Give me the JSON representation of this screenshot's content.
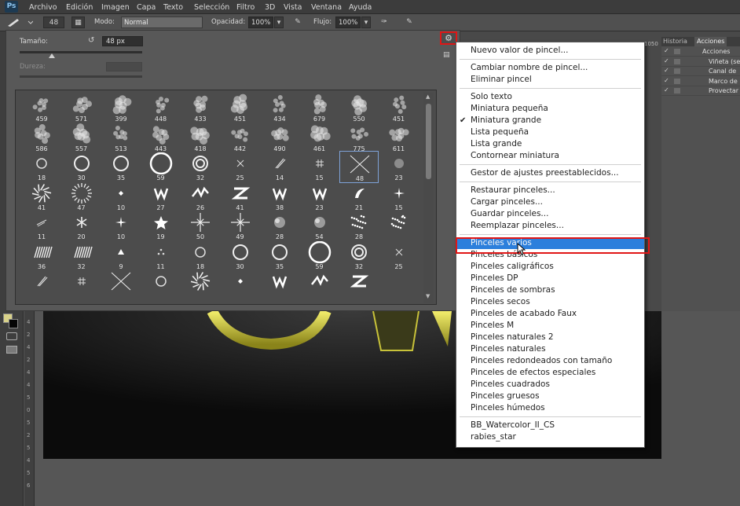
{
  "menubar": {
    "logo": "Ps",
    "items": [
      "Archivo",
      "Edición",
      "Imagen",
      "Capa",
      "Texto",
      "Selección",
      "Filtro",
      "3D",
      "Vista",
      "Ventana",
      "Ayuda"
    ]
  },
  "options": {
    "brush_size": "48",
    "mode_label": "Modo:",
    "mode_value": "Normal",
    "opacity_label": "Opacidad:",
    "opacity_value": "100%",
    "flow_label": "Flujo:",
    "flow_value": "100%"
  },
  "picker": {
    "size_label": "Tamaño:",
    "size_value": "48 px",
    "hardness_label": "Dureza:",
    "brush_numbers": [
      [
        "459",
        "571",
        "399",
        "448",
        "433",
        "451",
        "434",
        "679",
        "550",
        "451"
      ],
      [
        "586",
        "557",
        "513",
        "443",
        "418",
        "442",
        "490",
        "461",
        "775",
        "611"
      ],
      [
        "18",
        "30",
        "35",
        "59",
        "32",
        "25",
        "14",
        "15",
        "48",
        "23"
      ],
      [
        "41",
        "47",
        "10",
        "27",
        "26",
        "41",
        "38",
        "23",
        "21",
        "15"
      ],
      [
        "11",
        "20",
        "10",
        "19",
        "50",
        "49",
        "28",
        "54",
        "28",
        ""
      ],
      [
        "36",
        "32",
        "9",
        "11",
        "18",
        "30",
        "35",
        "59",
        "32",
        "25"
      ]
    ],
    "selected_brush": "48"
  },
  "side_panel": {
    "tabs": [
      "Historia",
      "Acciones"
    ],
    "items": [
      "Acciones",
      "Viñeta (se",
      "Canal de",
      "Marco de",
      "Provectar"
    ],
    "ruler_fragment": "1050"
  },
  "ruler_vertical": [
    "4",
    "2",
    "4",
    "2",
    "4",
    "4",
    "5",
    "0",
    "5",
    "2",
    "5",
    "4",
    "5",
    "6"
  ],
  "context_menu": {
    "groups": [
      [
        {
          "label": "Nuevo valor de pincel..."
        }
      ],
      [
        {
          "label": "Cambiar nombre de pincel..."
        },
        {
          "label": "Eliminar pincel"
        }
      ],
      [
        {
          "label": "Solo texto"
        },
        {
          "label": "Miniatura pequeña"
        },
        {
          "label": "Miniatura grande",
          "checked": true
        },
        {
          "label": "Lista pequeña"
        },
        {
          "label": "Lista grande"
        },
        {
          "label": "Contornear miniatura"
        }
      ],
      [
        {
          "label": "Gestor de ajustes preestablecidos..."
        }
      ],
      [
        {
          "label": "Restaurar pinceles..."
        },
        {
          "label": "Cargar pinceles..."
        },
        {
          "label": "Guardar pinceles..."
        },
        {
          "label": "Reemplazar pinceles..."
        }
      ],
      [
        {
          "label": "Pinceles varios",
          "highlighted": true
        },
        {
          "label": "Pinceles básicos"
        },
        {
          "label": "Pinceles caligráficos"
        },
        {
          "label": "Pinceles DP"
        },
        {
          "label": "Pinceles de sombras"
        },
        {
          "label": "Pinceles secos"
        },
        {
          "label": "Pinceles de acabado Faux"
        },
        {
          "label": "Pinceles M"
        },
        {
          "label": "Pinceles naturales 2"
        },
        {
          "label": "Pinceles naturales"
        },
        {
          "label": "Pinceles redondeados con tamaño"
        },
        {
          "label": "Pinceles de efectos especiales"
        },
        {
          "label": "Pinceles cuadrados"
        },
        {
          "label": "Pinceles gruesos"
        },
        {
          "label": "Pinceles húmedos"
        }
      ],
      [
        {
          "label": "BB_Watercolor_II_CS"
        },
        {
          "label": "rabies_star"
        }
      ]
    ]
  },
  "colors": {
    "highlight": "#2c7fdc",
    "annotation_red": "#e01616",
    "menu_bg": "#ffffff",
    "canvas_text": "#d8d245"
  },
  "icons": [
    "brush-tool-icon",
    "brush-panel-toggle-icon",
    "airbrush-icon",
    "pressure-size-icon",
    "gear-icon",
    "reset-icon",
    "checkmark-icon",
    "cursor-pointer-icon"
  ]
}
